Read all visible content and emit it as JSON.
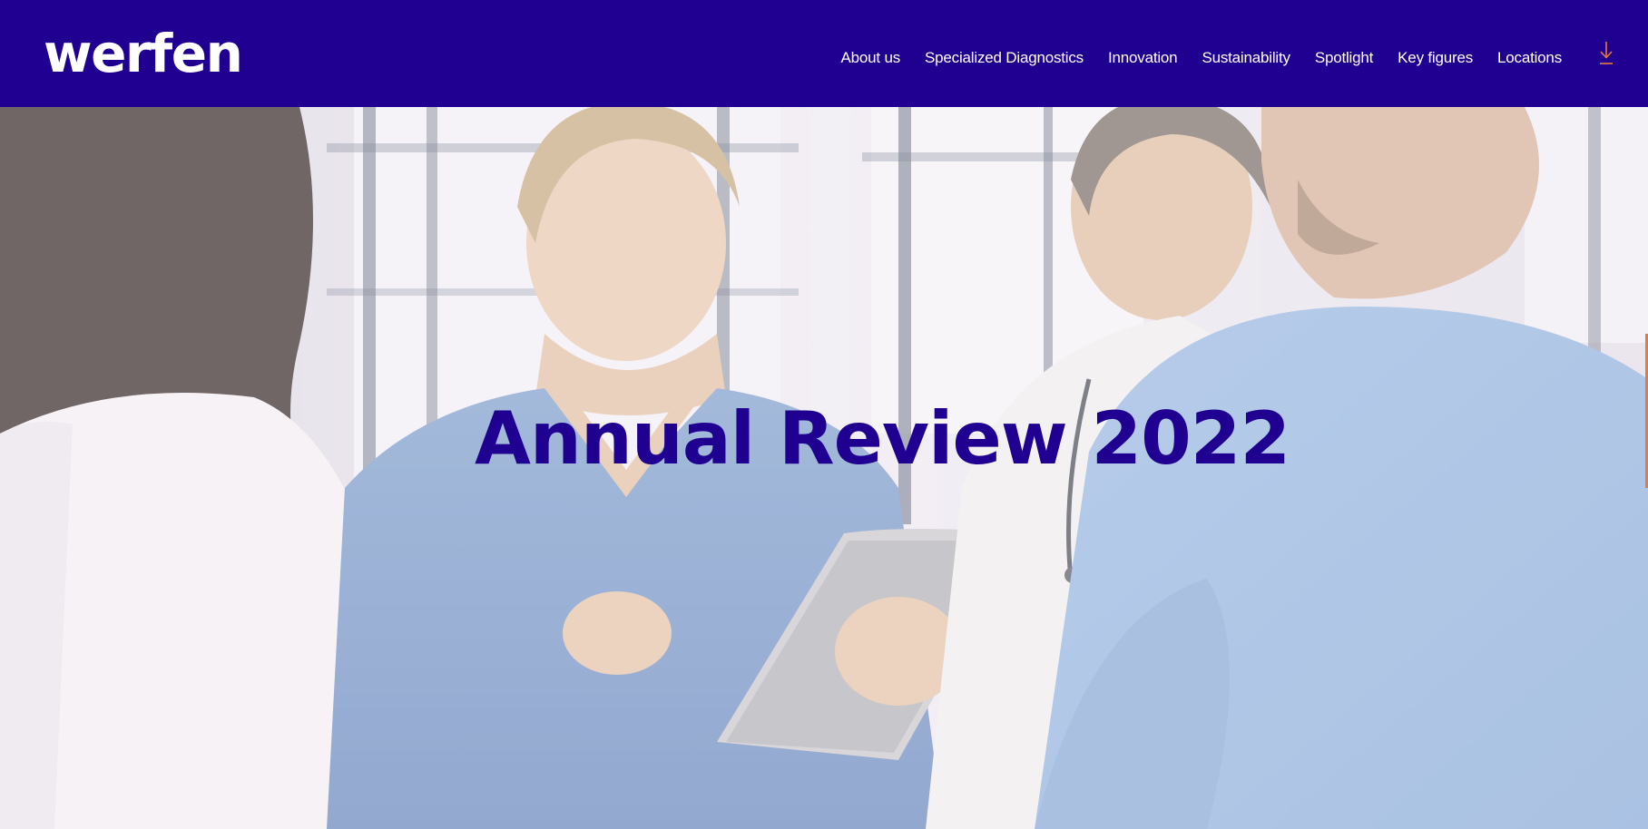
{
  "brand": {
    "logo_text": "werfen",
    "primary_color": "#1f0090",
    "accent_color": "#e87a3f"
  },
  "nav": {
    "items": [
      {
        "label": "About us"
      },
      {
        "label": "Specialized Diagnostics"
      },
      {
        "label": "Innovation"
      },
      {
        "label": "Sustainability"
      },
      {
        "label": "Spotlight"
      },
      {
        "label": "Key figures"
      },
      {
        "label": "Locations"
      }
    ],
    "download_icon": "download-icon"
  },
  "hero": {
    "title": "Annual Review 2022",
    "background_icon": "medical-team-photo"
  }
}
